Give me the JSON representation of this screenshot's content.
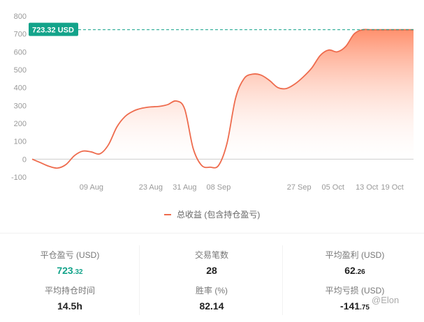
{
  "chart_data": {
    "type": "area",
    "x": [
      "2023-07-26",
      "2023-07-28",
      "2023-07-30",
      "2023-08-01",
      "2023-08-03",
      "2023-08-05",
      "2023-08-07",
      "2023-08-09",
      "2023-08-11",
      "2023-08-13",
      "2023-08-15",
      "2023-08-17",
      "2023-08-19",
      "2023-08-21",
      "2023-08-23",
      "2023-08-25",
      "2023-08-27",
      "2023-08-29",
      "2023-08-31",
      "2023-09-02",
      "2023-09-04",
      "2023-09-06",
      "2023-09-08",
      "2023-09-10",
      "2023-09-12",
      "2023-09-14",
      "2023-09-16",
      "2023-09-18",
      "2023-09-20",
      "2023-09-22",
      "2023-09-24",
      "2023-09-26",
      "2023-09-28",
      "2023-09-30",
      "2023-10-02",
      "2023-10-04",
      "2023-10-06",
      "2023-10-08",
      "2023-10-10",
      "2023-10-12",
      "2023-10-14",
      "2023-10-16",
      "2023-10-18",
      "2023-10-20",
      "2023-10-22",
      "2023-10-24"
    ],
    "values": [
      0,
      -20,
      -40,
      -50,
      -30,
      20,
      45,
      40,
      30,
      80,
      180,
      240,
      270,
      285,
      292,
      295,
      305,
      325,
      280,
      60,
      -35,
      -45,
      -35,
      90,
      340,
      450,
      475,
      470,
      440,
      400,
      395,
      420,
      460,
      510,
      580,
      610,
      600,
      630,
      700,
      723.32,
      723.32,
      723.32,
      723.32,
      723.32,
      723.32,
      723.32
    ],
    "x_ticks": [
      "09 Aug",
      "23 Aug",
      "31 Aug",
      "08 Sep",
      "27 Sep",
      "05 Oct",
      "13 Oct",
      "19 Oct"
    ],
    "x_tick_dates": [
      "2023-08-09",
      "2023-08-23",
      "2023-08-31",
      "2023-09-08",
      "2023-09-27",
      "2023-10-05",
      "2023-10-13",
      "2023-10-19"
    ],
    "y_ticks": [
      "800",
      "700",
      "600",
      "500",
      "400",
      "300",
      "200",
      "100",
      "0",
      "-100"
    ],
    "ylim": [
      -100,
      800
    ],
    "reference_value": 723.32,
    "reference_label": "723.32 USD",
    "series_name": "总收益 (包含持仓盈亏)",
    "line_color": "#ee6b4d",
    "fill_top_color": "#ff8a65",
    "accent_color": "#13a38a",
    "grid": false,
    "legend": "bottom-center"
  },
  "stats": {
    "closed_pnl_label": "平仓盈亏 (USD)",
    "closed_pnl_int": "723",
    "closed_pnl_dec": ".32",
    "trades_label": "交易笔数",
    "trades_value": "28",
    "avg_profit_label": "平均盈利 (USD)",
    "avg_profit_int": "62",
    "avg_profit_dec": ".26",
    "avg_hold_label": "平均持仓时间",
    "avg_hold_value": "14.5h",
    "win_rate_label": "胜率 (%)",
    "win_rate_value": "82.14",
    "avg_loss_label": "平均亏损 (USD)",
    "avg_loss_int": "-141",
    "avg_loss_dec": ".75"
  },
  "watermark": "@Elon"
}
